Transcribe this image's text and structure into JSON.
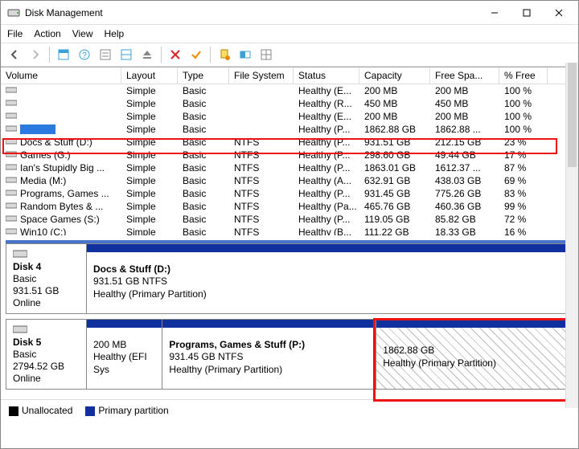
{
  "window": {
    "title": "Disk Management"
  },
  "menu": {
    "file": "File",
    "action": "Action",
    "view": "View",
    "help": "Help"
  },
  "columns": {
    "volume": "Volume",
    "layout": "Layout",
    "type": "Type",
    "fs": "File System",
    "status": "Status",
    "capacity": "Capacity",
    "free": "Free Spa...",
    "pct": "% Free"
  },
  "volumes": [
    {
      "name": "",
      "layout": "Simple",
      "type": "Basic",
      "fs": "",
      "status": "Healthy (E...",
      "cap": "200 MB",
      "free": "200 MB",
      "pct": "100 %"
    },
    {
      "name": "",
      "layout": "Simple",
      "type": "Basic",
      "fs": "",
      "status": "Healthy (R...",
      "cap": "450 MB",
      "free": "450 MB",
      "pct": "100 %"
    },
    {
      "name": "",
      "layout": "Simple",
      "type": "Basic",
      "fs": "",
      "status": "Healthy (E...",
      "cap": "200 MB",
      "free": "200 MB",
      "pct": "100 %"
    },
    {
      "name": "",
      "layout": "Simple",
      "type": "Basic",
      "fs": "",
      "status": "Healthy (P...",
      "cap": "1862.88 GB",
      "free": "1862.88 ...",
      "pct": "100 %",
      "selected": true
    },
    {
      "name": "Docs & Stuff (D:)",
      "layout": "Simple",
      "type": "Basic",
      "fs": "NTFS",
      "status": "Healthy (P...",
      "cap": "931.51 GB",
      "free": "212.15 GB",
      "pct": "23 %"
    },
    {
      "name": "Games (G:)",
      "layout": "Simple",
      "type": "Basic",
      "fs": "NTFS",
      "status": "Healthy (P...",
      "cap": "298.60 GB",
      "free": "49.44 GB",
      "pct": "17 %"
    },
    {
      "name": "Ian's Stupidly Big ...",
      "layout": "Simple",
      "type": "Basic",
      "fs": "NTFS",
      "status": "Healthy (P...",
      "cap": "1863.01 GB",
      "free": "1612.37 ...",
      "pct": "87 %"
    },
    {
      "name": "Media (M:)",
      "layout": "Simple",
      "type": "Basic",
      "fs": "NTFS",
      "status": "Healthy (A...",
      "cap": "632.91 GB",
      "free": "438.03 GB",
      "pct": "69 %"
    },
    {
      "name": "Programs, Games ...",
      "layout": "Simple",
      "type": "Basic",
      "fs": "NTFS",
      "status": "Healthy (P...",
      "cap": "931.45 GB",
      "free": "775.26 GB",
      "pct": "83 %"
    },
    {
      "name": "Random Bytes & ...",
      "layout": "Simple",
      "type": "Basic",
      "fs": "NTFS",
      "status": "Healthy (Pa...",
      "cap": "465.76 GB",
      "free": "460.36 GB",
      "pct": "99 %"
    },
    {
      "name": "Space Games (S:)",
      "layout": "Simple",
      "type": "Basic",
      "fs": "NTFS",
      "status": "Healthy (P...",
      "cap": "119.05 GB",
      "free": "85.82 GB",
      "pct": "72 %"
    },
    {
      "name": "Win10 (C:)",
      "layout": "Simple",
      "type": "Basic",
      "fs": "NTFS",
      "status": "Healthy (B...",
      "cap": "111.22 GB",
      "free": "18.33 GB",
      "pct": "16 %"
    }
  ],
  "disks": [
    {
      "label": "Disk 4",
      "type": "Basic",
      "size": "931.51 GB",
      "state": "Online",
      "parts": [
        {
          "title": "Docs & Stuff  (D:)",
          "line2": "931.51 GB NTFS",
          "line3": "Healthy (Primary Partition)",
          "grow": 1
        }
      ]
    },
    {
      "label": "Disk 5",
      "type": "Basic",
      "size": "2794.52 GB",
      "state": "Online",
      "parts": [
        {
          "title": "",
          "line2": "200 MB",
          "line3": "Healthy (EFI Sys",
          "grow": 0.14
        },
        {
          "title": "Programs, Games & Stuff  (P:)",
          "line2": "931.45 GB NTFS",
          "line3": "Healthy (Primary Partition)",
          "grow": 0.45
        },
        {
          "title": "",
          "line2": "1862.88 GB",
          "line3": "Healthy (Primary Partition)",
          "grow": 0.41,
          "hatch": true,
          "highlight": true
        }
      ]
    }
  ],
  "legend": {
    "unalloc": "Unallocated",
    "primary": "Primary partition"
  }
}
